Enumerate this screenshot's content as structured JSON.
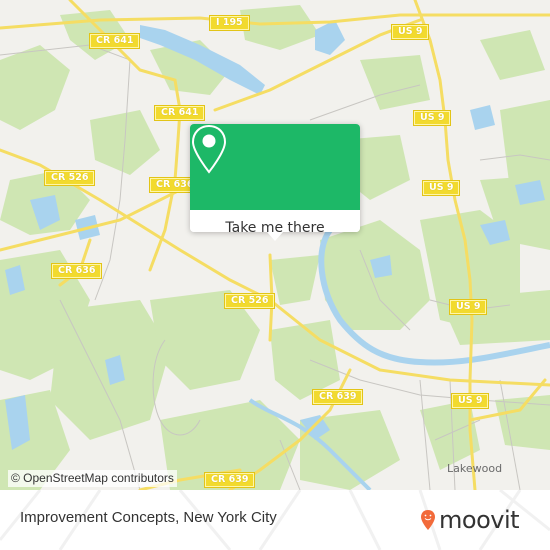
{
  "map": {
    "attribution": "© OpenStreetMap contributors",
    "colors": {
      "land": "#f2f1ed",
      "forest": "#cfe6b3",
      "water": "#a9d3ee",
      "road_major": "#f5dd63",
      "road_minor": "#c8c6c2",
      "shield": "#f2da2e"
    },
    "road_labels": [
      {
        "id": "i195",
        "text": "I 195"
      },
      {
        "id": "cr641-a",
        "text": "CR 641"
      },
      {
        "id": "cr641-b",
        "text": "CR 641"
      },
      {
        "id": "cr526-a",
        "text": "CR 526"
      },
      {
        "id": "cr636-a",
        "text": "CR 636"
      },
      {
        "id": "cr636-b",
        "text": "CR 636"
      },
      {
        "id": "cr526-b",
        "text": "CR 526"
      },
      {
        "id": "cr639-a",
        "text": "CR 639"
      },
      {
        "id": "cr639-b",
        "text": "CR 639"
      },
      {
        "id": "us9-a",
        "text": "US 9"
      },
      {
        "id": "us9-b",
        "text": "US 9"
      },
      {
        "id": "us9-c",
        "text": "US 9"
      },
      {
        "id": "us9-d",
        "text": "US 9"
      },
      {
        "id": "us9-e",
        "text": "US 9"
      }
    ],
    "places": [
      {
        "id": "lakewood",
        "text": "Lakewood"
      }
    ]
  },
  "popup": {
    "icon": "map-pin-icon",
    "button_label": "Take me there",
    "accent_color": "#1db867"
  },
  "footer": {
    "title": "Improvement Concepts, New York City",
    "brand": {
      "name": "moovit",
      "icon": "moovit-logo-icon",
      "color": "#f26a3a"
    }
  }
}
